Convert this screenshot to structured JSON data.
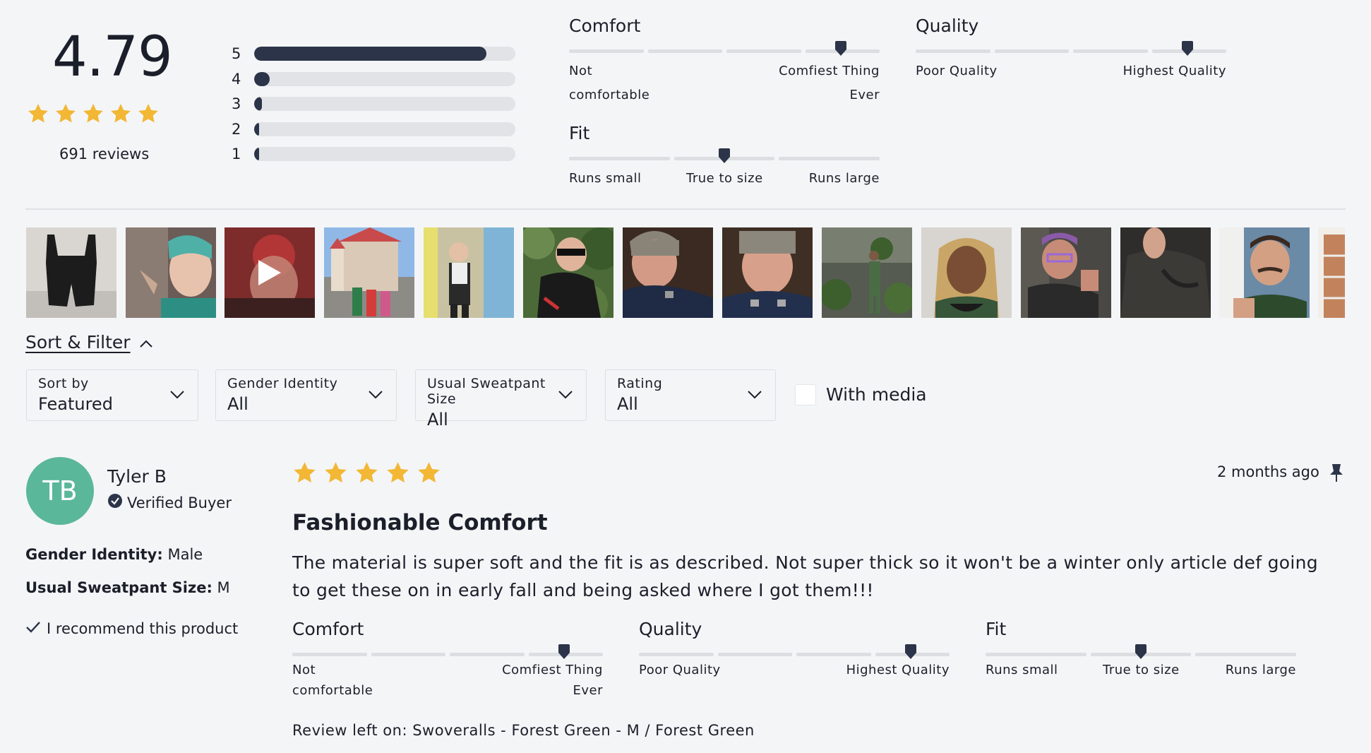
{
  "summary": {
    "average": "4.79",
    "review_count": "691 reviews",
    "histogram": [
      {
        "label": "5",
        "fraction": 0.89
      },
      {
        "label": "4",
        "fraction": 0.06
      },
      {
        "label": "3",
        "fraction": 0.03
      },
      {
        "label": "2",
        "fraction": 0.015
      },
      {
        "label": "1",
        "fraction": 0.01
      }
    ],
    "comfort": {
      "title": "Comfort",
      "low_label": "Not comfortable",
      "high_label": "Comfiest Thing Ever",
      "level": 0.875
    },
    "quality": {
      "title": "Quality",
      "low_label": "Poor Quality",
      "high_label": "Highest Quality",
      "level": 0.875
    },
    "fit": {
      "title": "Fit",
      "low_label": "Runs small",
      "mid_label": "True to size",
      "high_label": "Runs large",
      "level": 0.5
    }
  },
  "sort_filter": {
    "toggle_label": "Sort & Filter",
    "filters": [
      {
        "label": "Sort by",
        "value": "Featured"
      },
      {
        "label": "Gender Identity",
        "value": "All"
      },
      {
        "label": "Usual Sweatpant Size",
        "value": "All"
      },
      {
        "label": "Rating",
        "value": "All"
      }
    ],
    "with_media_label": "With media"
  },
  "review": {
    "initials": "TB",
    "avatar_color": "#5bb79a",
    "name": "Tyler B",
    "verified_label": "Verified Buyer",
    "gender_identity_key": "Gender Identity:",
    "gender_identity_value": "Male",
    "sweatpant_size_key": "Usual Sweatpant Size:",
    "sweatpant_size_value": "M",
    "recommend_label": "I recommend this product",
    "rating": 5,
    "date": "2 months ago",
    "title": "Fashionable Comfort",
    "body": "The material is super soft and the fit is as described. Not super thick so it won't be a winter only article def going to get these on in early fall and being asked where I got them!!!",
    "comfort": {
      "title": "Comfort",
      "low_label": "Not comfortable",
      "high_label": "Comfiest Thing Ever",
      "level": 0.875
    },
    "quality": {
      "title": "Quality",
      "low_label": "Poor Quality",
      "high_label": "Highest Quality",
      "level": 0.875
    },
    "fit": {
      "title": "Fit",
      "low_label": "Runs small",
      "mid_label": "True to size",
      "high_label": "Runs large",
      "level": 0.5
    },
    "review_left_on": "Review left on: Swoveralls - Forest Green - M / Forest Green"
  },
  "colors": {
    "star": "#f2b734",
    "bar_fill": "#2b3448",
    "marker": "#2b3448"
  }
}
